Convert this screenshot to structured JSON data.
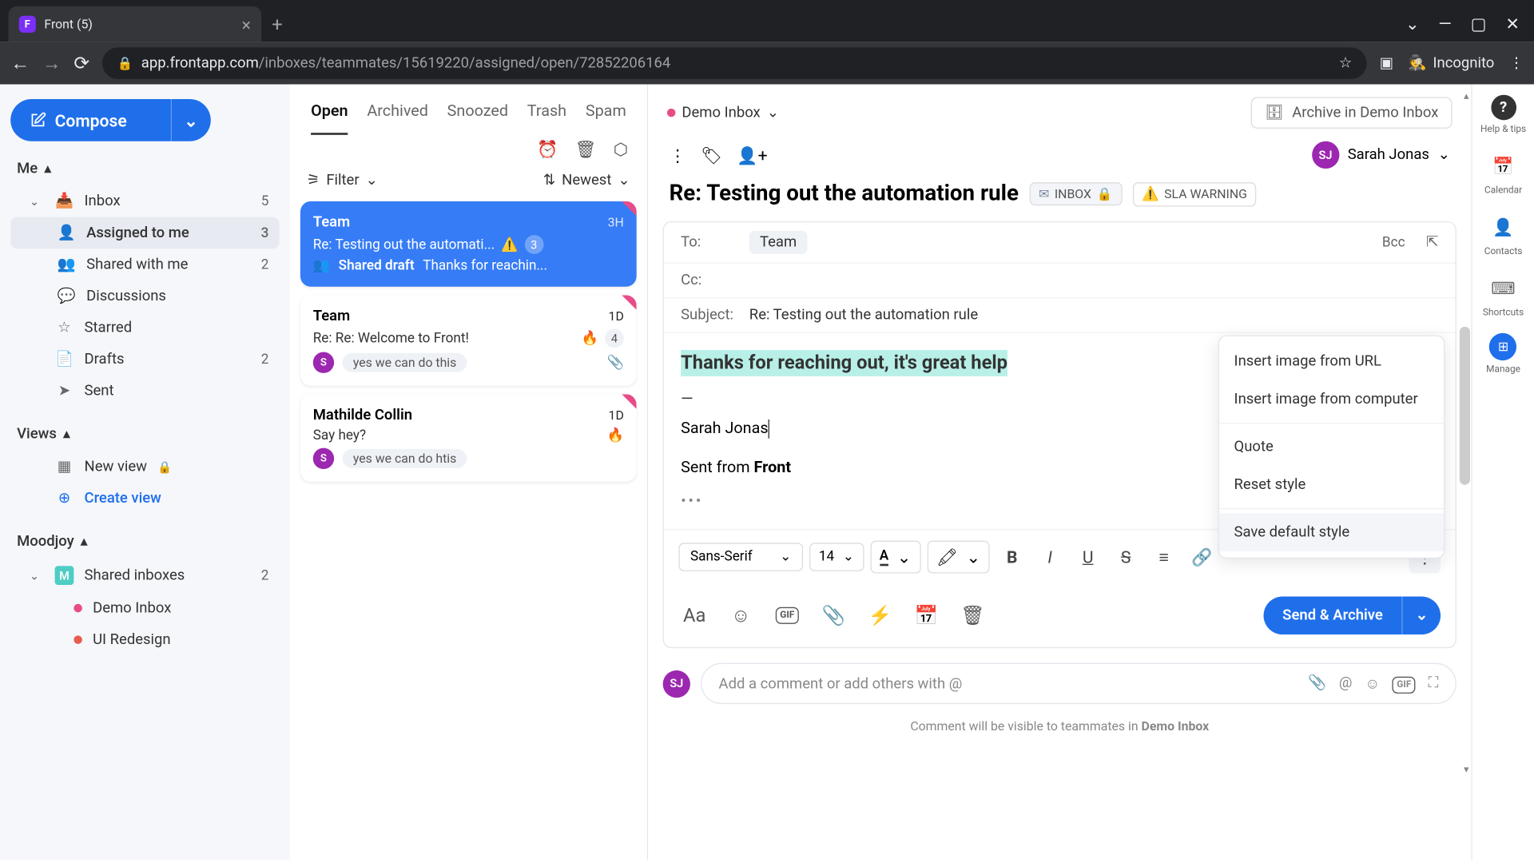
{
  "browser": {
    "tab_title": "Front (5)",
    "url_domain": "app.frontapp.com",
    "url_path": "/inboxes/teammates/15619220/assigned/open/72852206164",
    "incognito_label": "Incognito"
  },
  "sidebar": {
    "compose_label": "Compose",
    "me_label": "Me",
    "inbox": {
      "label": "Inbox",
      "count": "5"
    },
    "assigned": {
      "label": "Assigned to me",
      "count": "3"
    },
    "shared": {
      "label": "Shared with me",
      "count": "2"
    },
    "discussions": {
      "label": "Discussions"
    },
    "starred": {
      "label": "Starred"
    },
    "drafts": {
      "label": "Drafts",
      "count": "2"
    },
    "sent": {
      "label": "Sent"
    },
    "views_label": "Views",
    "new_view": {
      "label": "New view"
    },
    "create_view": {
      "label": "Create view"
    },
    "moodjoy_label": "Moodjoy",
    "shared_inboxes": {
      "label": "Shared inboxes",
      "count": "2"
    },
    "demo_inbox": {
      "label": "Demo Inbox"
    },
    "ui_redesign": {
      "label": "UI Redesign"
    }
  },
  "conv_tabs": {
    "open": "Open",
    "archived": "Archived",
    "snoozed": "Snoozed",
    "trash": "Trash",
    "spam": "Spam"
  },
  "filter_label": "Filter",
  "sort_label": "Newest",
  "conversations": [
    {
      "sender": "Team",
      "time": "3H",
      "subject": "Re: Testing out the automati...",
      "badge": "3",
      "draft_label": "Shared draft",
      "draft_preview": "Thanks for reachin..."
    },
    {
      "sender": "Team",
      "time": "1D",
      "subject": "Re: Re: Welcome to Front!",
      "badge": "4",
      "avatar_initial": "S",
      "pill": "yes we can do this"
    },
    {
      "sender": "Mathilde Collin",
      "time": "1D",
      "subject": "Say hey?",
      "avatar_initial": "S",
      "pill": "yes we can do htis"
    }
  ],
  "main": {
    "inbox_tag": "Demo Inbox",
    "archive_label": "Archive in Demo Inbox",
    "assignee_name": "Sarah Jonas",
    "assignee_initials": "SJ",
    "subject": "Re: Testing out the automation rule",
    "inbox_pill": "INBOX",
    "sla_pill": "SLA WARNING",
    "to_label": "To:",
    "to_value": "Team",
    "cc_label": "Cc:",
    "bcc_label": "Bcc",
    "subject_label": "Subject:",
    "subject_value": "Re: Testing out the automation rule",
    "body_highlight": "Thanks for reaching out, it's great help",
    "sig_name": "Sarah Jonas",
    "sent_from_prefix": "Sent from ",
    "sent_from_app": "Front",
    "font_family": "Sans-Serif",
    "font_size": "14",
    "send_label": "Send & Archive"
  },
  "context_menu": {
    "insert_url": "Insert image from URL",
    "insert_computer": "Insert image from computer",
    "quote": "Quote",
    "reset_style": "Reset style",
    "save_default": "Save default style"
  },
  "comment": {
    "placeholder": "Add a comment or add others with @",
    "note_prefix": "Comment will be visible to teammates in ",
    "note_inbox": "Demo Inbox"
  },
  "rail": {
    "help": "Help & tips",
    "calendar": "Calendar",
    "contacts": "Contacts",
    "shortcuts": "Shortcuts",
    "manage": "Manage"
  }
}
